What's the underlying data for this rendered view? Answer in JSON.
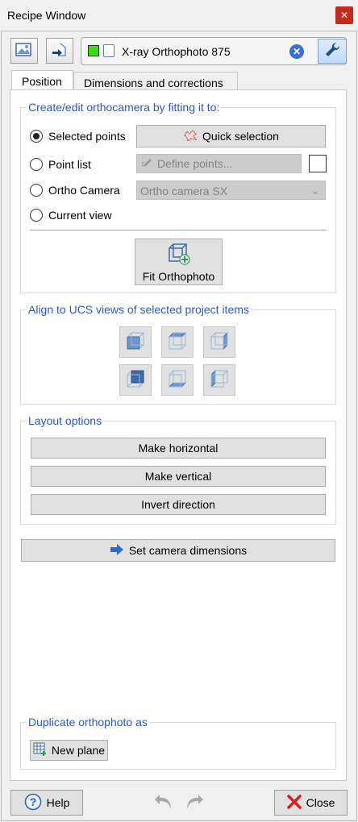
{
  "window": {
    "title": "Recipe Window",
    "close_label": "✕"
  },
  "toolbar": {
    "object_name": "X-ray Orthophoto 875",
    "object_color": "#3cdc14"
  },
  "tabs": [
    {
      "label": "Position",
      "active": true
    },
    {
      "label": "Dimensions and corrections",
      "active": false
    }
  ],
  "fit_group": {
    "title": "Create/edit orthocamera by fitting it to:",
    "options": [
      {
        "label": "Selected points",
        "checked": true
      },
      {
        "label": "Point list",
        "checked": false
      },
      {
        "label": "Ortho Camera",
        "checked": false
      },
      {
        "label": "Current view",
        "checked": false
      }
    ],
    "quick_selection_label": "Quick selection",
    "define_points_label": "Define points...",
    "ortho_camera_value": "Ortho camera SX",
    "fit_button_label": "Fit Orthophoto"
  },
  "ucs_group": {
    "title": "Align to UCS views of selected project items"
  },
  "layout_group": {
    "title": "Layout options",
    "buttons": [
      "Make horizontal",
      "Make vertical",
      "Invert direction"
    ]
  },
  "set_camera_label": "Set camera dimensions",
  "duplicate_group": {
    "title": "Duplicate orthophoto as",
    "new_plane_label": "New plane"
  },
  "footer": {
    "help_label": "Help",
    "close_label": "Close"
  }
}
